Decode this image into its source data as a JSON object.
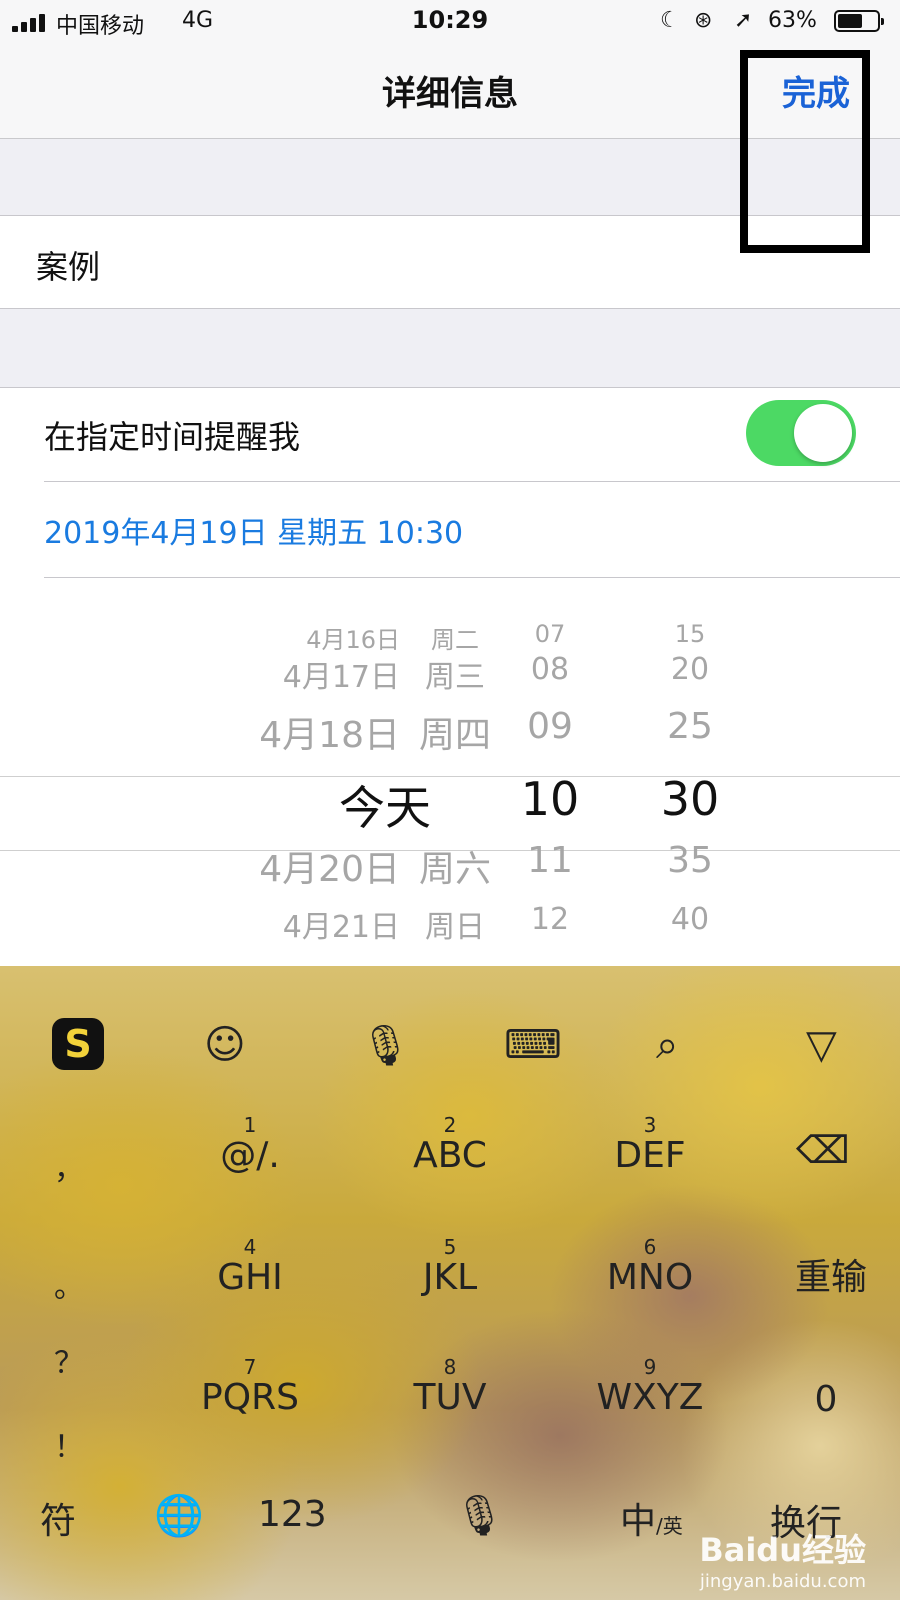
{
  "status_bar": {
    "carrier": "中国移动",
    "network": "4G",
    "time": "10:29",
    "battery_percent": "63%",
    "battery_level": 0.63,
    "icons": [
      "signal-icon",
      "moon-icon",
      "rotation-lock-icon",
      "location-icon",
      "battery-icon"
    ]
  },
  "nav": {
    "title": "详细信息",
    "done_label": "完成"
  },
  "reminder": {
    "title": "案例",
    "remind_label": "在指定时间提醒我",
    "remind_on": true,
    "date_text": "2019年4月19日 星期五 10:30",
    "accent_color": "#1a7be0",
    "toggle_color": "#4cd964"
  },
  "picker": {
    "rows": [
      {
        "date": "4月16日",
        "day": "周二",
        "hour": "07",
        "minute": "15"
      },
      {
        "date": "4月17日",
        "day": "周三",
        "hour": "08",
        "minute": "20"
      },
      {
        "date": "4月18日",
        "day": "周四",
        "hour": "09",
        "minute": "25"
      },
      {
        "date": "今天",
        "day": "",
        "hour": "10",
        "minute": "30"
      },
      {
        "date": "4月20日",
        "day": "周六",
        "hour": "11",
        "minute": "35"
      },
      {
        "date": "4月21日",
        "day": "周日",
        "hour": "12",
        "minute": "40"
      }
    ]
  },
  "keyboard": {
    "toolbar_icons": [
      "sogou-logo-icon",
      "emoji-icon",
      "microphone-icon",
      "keyboard-icon",
      "search-icon",
      "collapse-icon"
    ],
    "side_symbols": [
      "，",
      "。",
      "？",
      "！"
    ],
    "keys": [
      {
        "num": "1",
        "label": "@/."
      },
      {
        "num": "2",
        "label": "ABC"
      },
      {
        "num": "3",
        "label": "DEF"
      },
      {
        "num": "4",
        "label": "GHI"
      },
      {
        "num": "5",
        "label": "JKL"
      },
      {
        "num": "6",
        "label": "MNO"
      },
      {
        "num": "7",
        "label": "PQRS"
      },
      {
        "num": "8",
        "label": "TUV"
      },
      {
        "num": "9",
        "label": "WXYZ"
      }
    ],
    "reinput_label": "重输",
    "zero_label": "0",
    "symbols_label": "符",
    "numbers_label": "123",
    "lang_label": "中",
    "lang_sub": "/英",
    "newline_label": "换行"
  },
  "watermark": {
    "brand": "Baidu经验",
    "url": "jingyan.baidu.com"
  }
}
